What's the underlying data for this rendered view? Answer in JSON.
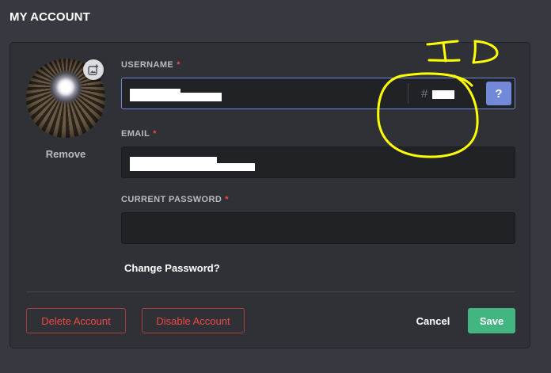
{
  "page": {
    "title": "MY ACCOUNT"
  },
  "avatar": {
    "remove_label": "Remove",
    "upload_icon": "image-add-icon"
  },
  "username": {
    "label": "USERNAME",
    "required_mark": "*",
    "discriminator_prefix": "#",
    "help_label": "?"
  },
  "email": {
    "label": "EMAIL",
    "required_mark": "*"
  },
  "password": {
    "label": "CURRENT PASSWORD",
    "required_mark": "*"
  },
  "links": {
    "change_password": "Change Password?"
  },
  "actions": {
    "delete_label": "Delete Account",
    "disable_label": "Disable Account",
    "cancel_label": "Cancel",
    "save_label": "Save"
  },
  "annotation": {
    "text": "ID",
    "color": "#ffff00"
  },
  "colors": {
    "background": "#36393f",
    "card": "#2f3136",
    "input": "#202225",
    "blurple": "#7289da",
    "save_green": "#43b581",
    "danger_red": "#f04747"
  }
}
